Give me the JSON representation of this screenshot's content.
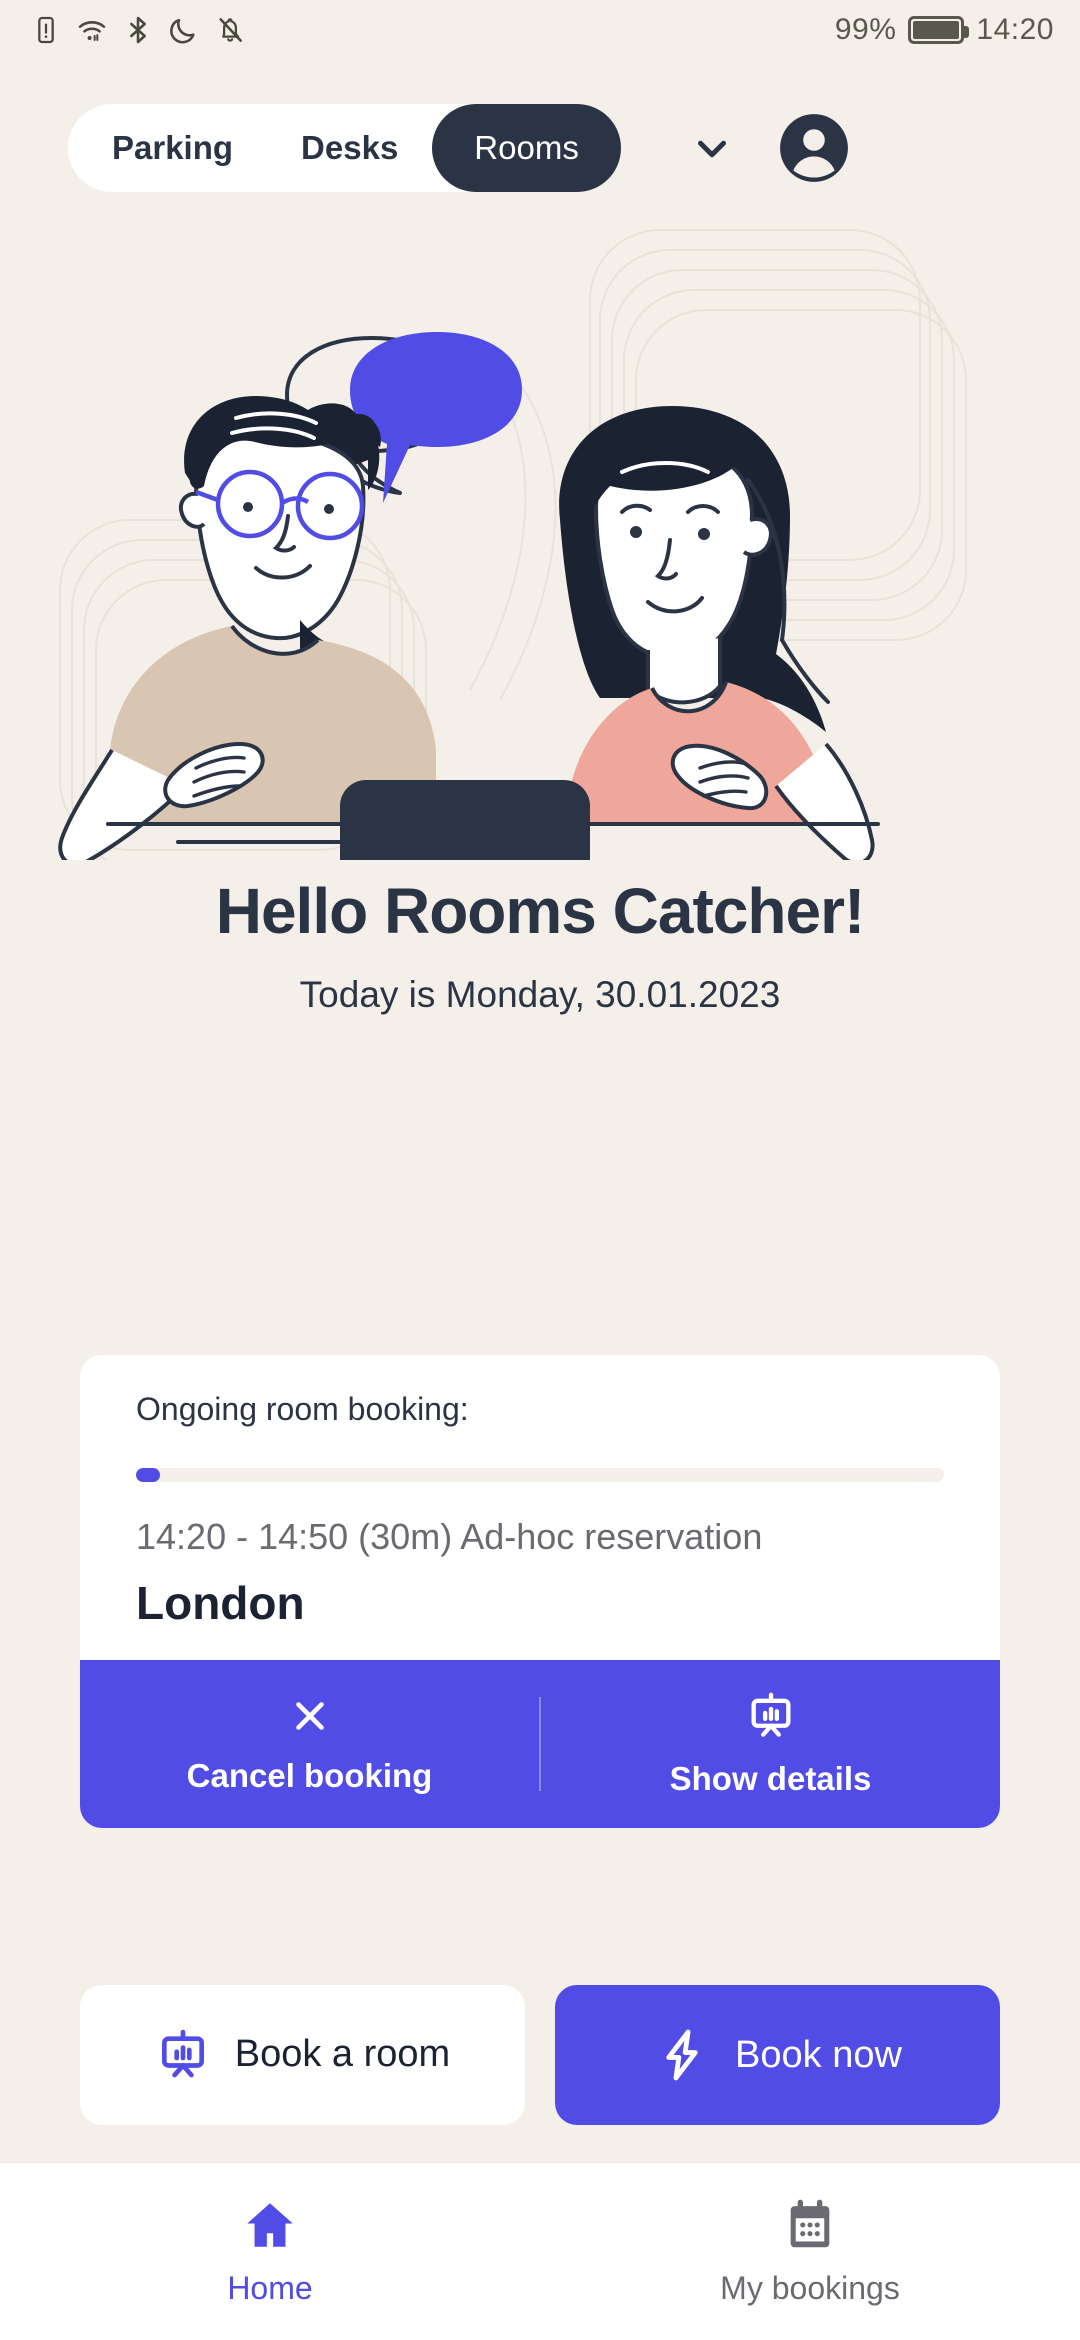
{
  "status_bar": {
    "icons": [
      "sim-warning-icon",
      "wifi-icon",
      "bluetooth-icon",
      "do-not-disturb-icon",
      "notifications-muted-icon"
    ],
    "battery_percent": "99%",
    "time": "14:20"
  },
  "top_bar": {
    "tabs": [
      {
        "label": "Parking",
        "active": false
      },
      {
        "label": "Desks",
        "active": false
      },
      {
        "label": "Rooms",
        "active": true
      }
    ],
    "chevron": "chevron-down-icon",
    "avatar": "account-avatar-icon"
  },
  "hero": {
    "illustration": "two-people-with-laptop-illustration",
    "greeting": "Hello Rooms Catcher!",
    "subgreeting": "Today is Monday, 30.01.2023"
  },
  "booking_card": {
    "title": "Ongoing room booking:",
    "progress_percent": 3,
    "time_range": "14:20 - 14:50 (30m) Ad-hoc reservation",
    "room": "London",
    "actions": [
      {
        "label": "Cancel booking",
        "icon": "close-icon"
      },
      {
        "label": "Show details",
        "icon": "presentation-board-icon"
      }
    ]
  },
  "buttons": [
    {
      "label": "Book a room",
      "icon": "presentation-board-icon",
      "style": "light"
    },
    {
      "label": "Book now",
      "icon": "lightning-bolt-icon",
      "style": "primary"
    }
  ],
  "bottom_nav": [
    {
      "label": "Home",
      "icon": "home-icon",
      "active": true
    },
    {
      "label": "My bookings",
      "icon": "calendar-icon",
      "active": false
    }
  ],
  "colors": {
    "background": "#F4F0E9",
    "accent_purple": "#504CE5",
    "dark_navy": "#2B3445",
    "card_white": "#FFFFFF",
    "muted_text": "#6B6A72"
  }
}
